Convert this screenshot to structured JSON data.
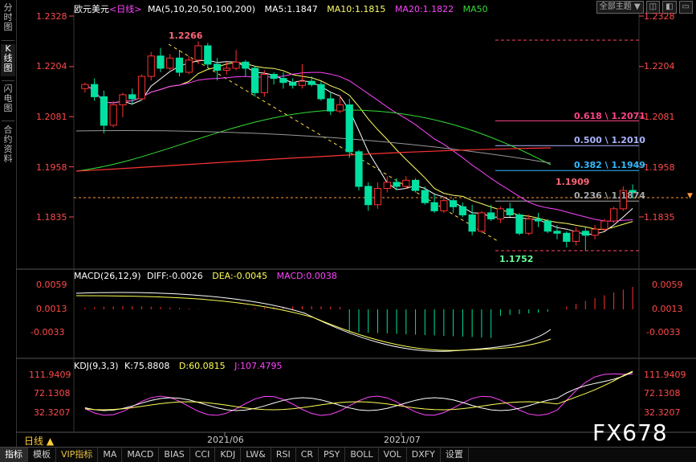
{
  "left_tabs": [
    {
      "name": "fenshi",
      "lines": [
        "分",
        "时",
        "图"
      ],
      "active": false
    },
    {
      "name": "kxian",
      "lines": [
        "K",
        "线",
        "图"
      ],
      "active": true
    },
    {
      "name": "shandian",
      "lines": [
        "闪",
        "电",
        "图"
      ],
      "active": false
    },
    {
      "name": "heyue",
      "lines": [
        "合",
        "约",
        "资",
        "料"
      ],
      "active": false
    }
  ],
  "top": {
    "symbol": "欧元美元",
    "period_tag": "<日线>",
    "ma_title": "MA(5,10,20,50,100,200)",
    "ma5": "MA5:1.1847",
    "ma10": "MA10:1.1815",
    "ma20": "MA20:1.1822",
    "ma50": "MA50",
    "btn_theme": "全部主题",
    "btn_arrow": "▼"
  },
  "colors": {
    "up": "#ff3030",
    "down": "#00e0a0",
    "ma5": "#ffffff",
    "ma10": "#ffff66",
    "ma20": "#ff44ff",
    "ma50": "#33dd33",
    "ma100": "#999999",
    "ma200": "#ff3333",
    "dif": "#ffffff",
    "dea": "#ffff55",
    "macdpink": "#ff44ff",
    "axis": "#ff4a4a"
  },
  "price_axis": [
    "1.2328",
    "1.2204",
    "1.2081",
    "1.1958",
    "1.1835"
  ],
  "annotations": {
    "high": "1.2266",
    "low": "1.1752",
    "last": "1.1909"
  },
  "fib": [
    {
      "label": "0.618 \\ 1.2071",
      "color": "#ff4488",
      "price": 1.2071
    },
    {
      "label": "0.500 \\ 1.2010",
      "color": "#aab4ff",
      "price": 1.201
    },
    {
      "label": "0.382 \\ 1.1949",
      "color": "#33bbff",
      "price": 1.1949
    },
    {
      "label": "0.236 \\ 1.1874",
      "color": "#aaaaaa",
      "price": 1.1874
    }
  ],
  "macd": {
    "title": "MACD(26,12,9)",
    "diff": "DIFF:-0.0026",
    "dea": "DEA:-0.0045",
    "macd": "MACD:0.0038",
    "axis": [
      "0.0059",
      "0.0013",
      "-0.0033"
    ]
  },
  "kdj": {
    "title": "KDJ(9,3,3)",
    "k": "K:75.8808",
    "d": "D:60.0815",
    "j": "J:107.4795",
    "axis": [
      "111.9409",
      "72.1308",
      "32.3207"
    ]
  },
  "period_label": "日线 ▲",
  "dates": [
    "2021/06",
    "2021/07"
  ],
  "bottom_tabs": [
    "指标",
    "模板",
    "VIP指标",
    "MA",
    "MACD",
    "BIAS",
    "CCI",
    "KDJ",
    "LW&",
    "RSI",
    "CR",
    "PSY",
    "BOLL",
    "VOL",
    "DXFY",
    "设置"
  ],
  "watermark": "FX678",
  "chart_data": {
    "type": "candlestick",
    "ylim": [
      1.17,
      1.235
    ],
    "candles": [
      [
        1.215,
        1.2165,
        1.214,
        1.216
      ],
      [
        1.216,
        1.2175,
        1.212,
        1.213
      ],
      [
        1.213,
        1.2145,
        1.204,
        1.206
      ],
      [
        1.206,
        1.212,
        1.2055,
        1.211
      ],
      [
        1.211,
        1.214,
        1.208,
        1.2135
      ],
      [
        1.2135,
        1.215,
        1.211,
        1.2125
      ],
      [
        1.2125,
        1.2185,
        1.212,
        1.218
      ],
      [
        1.218,
        1.224,
        1.217,
        1.223
      ],
      [
        1.223,
        1.225,
        1.219,
        1.22
      ],
      [
        1.22,
        1.2235,
        1.2195,
        1.2225
      ],
      [
        1.2225,
        1.2245,
        1.218,
        1.219
      ],
      [
        1.219,
        1.223,
        1.2185,
        1.222
      ],
      [
        1.222,
        1.2266,
        1.221,
        1.2255
      ],
      [
        1.2255,
        1.2262,
        1.22,
        1.221
      ],
      [
        1.221,
        1.2225,
        1.217,
        1.2195
      ],
      [
        1.2195,
        1.2215,
        1.2185,
        1.22
      ],
      [
        1.22,
        1.2245,
        1.2195,
        1.2215
      ],
      [
        1.2215,
        1.222,
        1.218,
        1.22
      ],
      [
        1.22,
        1.2205,
        1.213,
        1.214
      ],
      [
        1.214,
        1.2195,
        1.213,
        1.2185
      ],
      [
        1.2185,
        1.219,
        1.216,
        1.2175
      ],
      [
        1.2175,
        1.219,
        1.215,
        1.2165
      ],
      [
        1.2165,
        1.2175,
        1.215,
        1.2158
      ],
      [
        1.2158,
        1.221,
        1.215,
        1.2168
      ],
      [
        1.2168,
        1.218,
        1.2155,
        1.216
      ],
      [
        1.216,
        1.2168,
        1.212,
        1.2125
      ],
      [
        1.2125,
        1.214,
        1.2085,
        1.2095
      ],
      [
        1.2095,
        1.2135,
        1.209,
        1.211
      ],
      [
        1.211,
        1.2125,
        1.198,
        1.1995
      ],
      [
        1.1995,
        1.2,
        1.19,
        1.191
      ],
      [
        1.191,
        1.192,
        1.185,
        1.1865
      ],
      [
        1.1865,
        1.192,
        1.1855,
        1.1905
      ],
      [
        1.1905,
        1.1935,
        1.1895,
        1.192
      ],
      [
        1.192,
        1.193,
        1.19,
        1.191
      ],
      [
        1.191,
        1.1935,
        1.1905,
        1.1925
      ],
      [
        1.1925,
        1.193,
        1.1895,
        1.19
      ],
      [
        1.19,
        1.191,
        1.1865,
        1.187
      ],
      [
        1.187,
        1.189,
        1.1845,
        1.185
      ],
      [
        1.185,
        1.1885,
        1.1845,
        1.1875
      ],
      [
        1.1875,
        1.188,
        1.1845,
        1.186
      ],
      [
        1.186,
        1.187,
        1.1835,
        1.184
      ],
      [
        1.184,
        1.1865,
        1.179,
        1.18
      ],
      [
        1.18,
        1.185,
        1.1795,
        1.1845
      ],
      [
        1.1845,
        1.1865,
        1.1825,
        1.183
      ],
      [
        1.183,
        1.186,
        1.182,
        1.1855
      ],
      [
        1.1855,
        1.187,
        1.1835,
        1.184
      ],
      [
        1.184,
        1.1845,
        1.179,
        1.1795
      ],
      [
        1.1795,
        1.184,
        1.179,
        1.183
      ],
      [
        1.183,
        1.1845,
        1.181,
        1.1825
      ],
      [
        1.1825,
        1.183,
        1.1795,
        1.18
      ],
      [
        1.18,
        1.1815,
        1.178,
        1.1795
      ],
      [
        1.1795,
        1.18,
        1.176,
        1.1775
      ],
      [
        1.1775,
        1.181,
        1.1765,
        1.18
      ],
      [
        1.18,
        1.181,
        1.1752,
        1.179
      ],
      [
        1.179,
        1.1815,
        1.178,
        1.1805
      ],
      [
        1.1805,
        1.183,
        1.18,
        1.1825
      ],
      [
        1.1825,
        1.186,
        1.182,
        1.1855
      ],
      [
        1.1855,
        1.191,
        1.185,
        1.19
      ],
      [
        1.19,
        1.1915,
        1.188,
        1.1895
      ]
    ]
  }
}
